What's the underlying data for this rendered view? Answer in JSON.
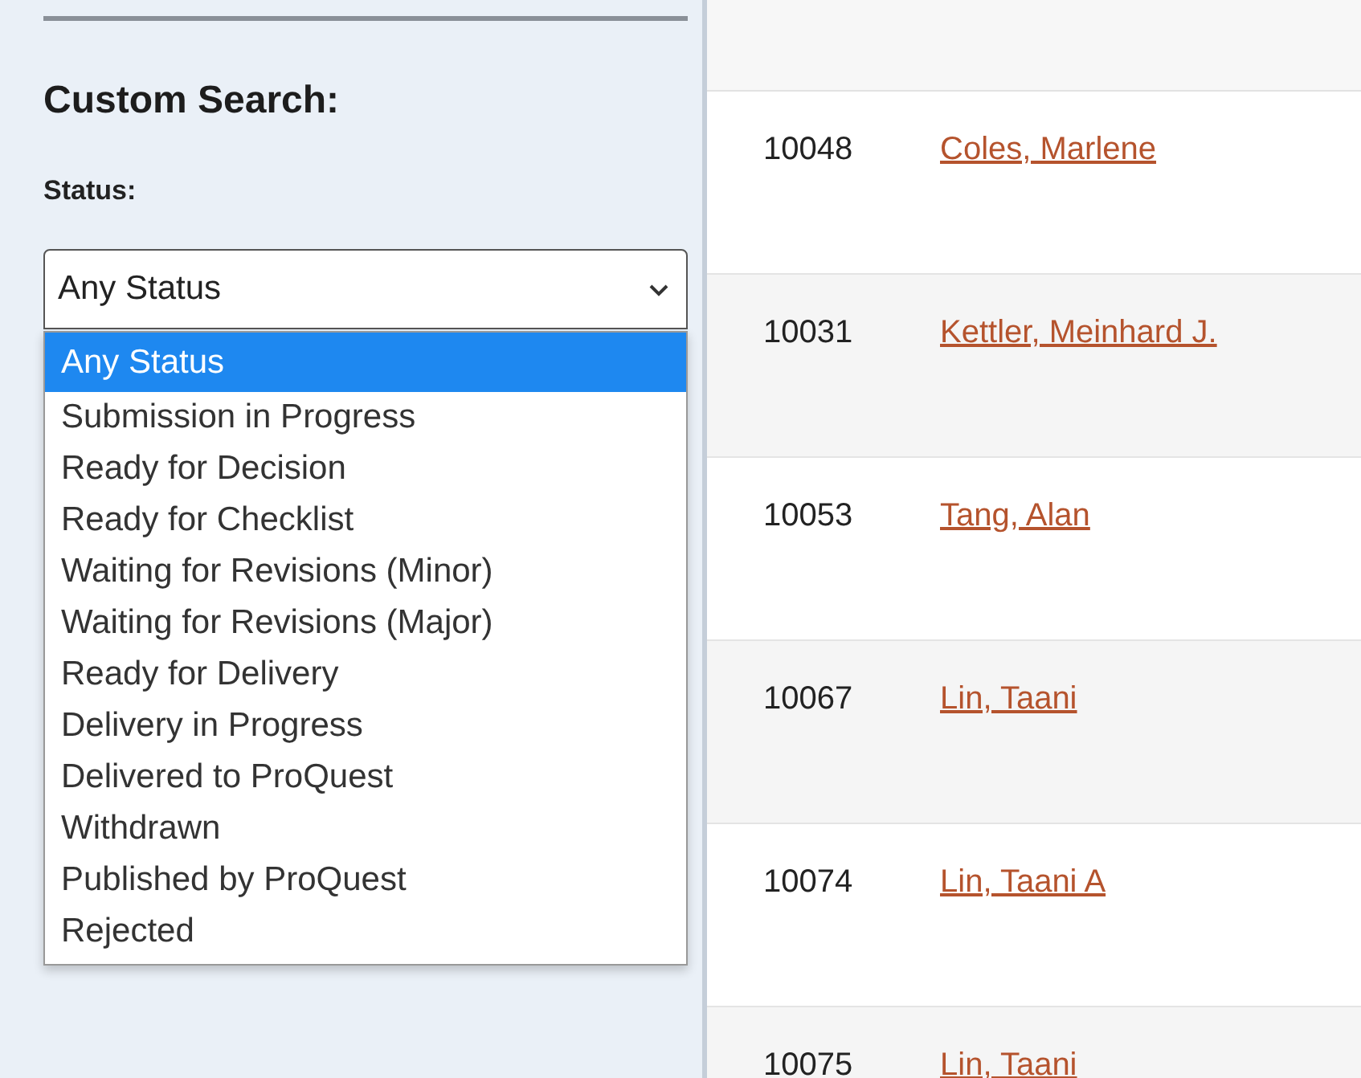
{
  "sidebar": {
    "title": "Custom Search:",
    "status_label": "Status:",
    "status_select": {
      "value": "Any Status",
      "expanded": true,
      "options": [
        {
          "label": "Any Status",
          "selected": true
        },
        {
          "label": "Submission in Progress",
          "selected": false
        },
        {
          "label": "Ready for Decision",
          "selected": false
        },
        {
          "label": "Ready for Checklist",
          "selected": false
        },
        {
          "label": "Waiting for Revisions (Minor)",
          "selected": false
        },
        {
          "label": "Waiting for Revisions (Major)",
          "selected": false
        },
        {
          "label": "Ready for Delivery",
          "selected": false
        },
        {
          "label": "Delivery in Progress",
          "selected": false
        },
        {
          "label": "Delivered to ProQuest",
          "selected": false
        },
        {
          "label": "Withdrawn",
          "selected": false
        },
        {
          "label": "Published by ProQuest",
          "selected": false
        },
        {
          "label": "Rejected",
          "selected": false
        }
      ]
    }
  },
  "table": {
    "rows": [
      {
        "id": "10048",
        "name": "Coles, Marlene"
      },
      {
        "id": "10031",
        "name": "Kettler, Meinhard J."
      },
      {
        "id": "10053",
        "name": "Tang, Alan"
      },
      {
        "id": "10067",
        "name": "Lin, Taani"
      },
      {
        "id": "10074",
        "name": "Lin, Taani A"
      },
      {
        "id": "10075",
        "name": "Lin, Taani"
      }
    ]
  }
}
